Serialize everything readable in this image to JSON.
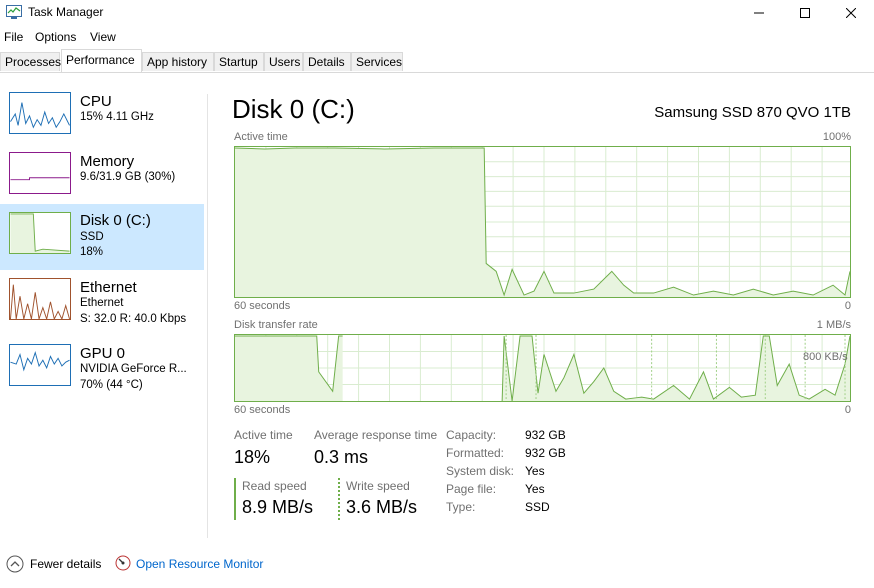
{
  "window": {
    "title": "Task Manager"
  },
  "menu": {
    "file": "File",
    "options": "Options",
    "view": "View"
  },
  "tabs": [
    "Processes",
    "Performance",
    "App history",
    "Startup",
    "Users",
    "Details",
    "Services"
  ],
  "sidebar": [
    {
      "title": "CPU",
      "line1": "15%  4.11 GHz",
      "line2": ""
    },
    {
      "title": "Memory",
      "line1": "9.6/31.9 GB (30%)",
      "line2": ""
    },
    {
      "title": "Disk 0 (C:)",
      "line1": "SSD",
      "line2": "18%"
    },
    {
      "title": "Ethernet",
      "line1": "Ethernet",
      "line2": "S: 32.0  R: 40.0 Kbps"
    },
    {
      "title": "GPU 0",
      "line1": "NVIDIA GeForce R...",
      "line2": "70%  (44 °C)"
    }
  ],
  "main": {
    "title": "Disk 0 (C:)",
    "model": "Samsung SSD 870 QVO 1TB",
    "graph1": {
      "label": "Active time",
      "max": "100%",
      "time": "60 seconds",
      "min": "0"
    },
    "graph2": {
      "label": "Disk transfer rate",
      "max": "1 MB/s",
      "mid": "800 KB/s",
      "time": "60 seconds",
      "min": "0"
    },
    "stats": {
      "active_time_label": "Active time",
      "active_time": "18%",
      "avg_resp_label": "Average response time",
      "avg_resp": "0.3 ms",
      "read_label": "Read speed",
      "read": "8.9 MB/s",
      "write_label": "Write speed",
      "write": "3.6 MB/s"
    },
    "props": [
      {
        "k": "Capacity:",
        "v": "932 GB"
      },
      {
        "k": "Formatted:",
        "v": "932 GB"
      },
      {
        "k": "System disk:",
        "v": "Yes"
      },
      {
        "k": "Page file:",
        "v": "Yes"
      },
      {
        "k": "Type:",
        "v": "SSD"
      }
    ]
  },
  "footer": {
    "fewer": "Fewer details",
    "monitor": "Open Resource Monitor"
  },
  "colors": {
    "disk": "#6fae4a",
    "cpu": "#1e6fb5",
    "memory": "#8b1a8b",
    "ethernet": "#a0522d",
    "gpu": "#1e6fb5",
    "selected": "#cce8ff"
  }
}
